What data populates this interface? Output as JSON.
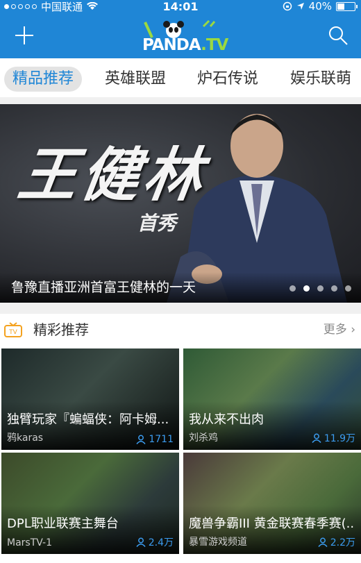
{
  "status_bar": {
    "carrier": "中国联通",
    "time": "14:01",
    "battery": "40%"
  },
  "header": {
    "logo_text": "PANDA",
    "logo_tv": ".TV"
  },
  "tabs": [
    {
      "label": "精品推荐"
    },
    {
      "label": "英雄联盟"
    },
    {
      "label": "炉石传说"
    },
    {
      "label": "娱乐联萌"
    }
  ],
  "banner": {
    "big_text": "王健林",
    "sub_text": "首秀",
    "caption": "鲁豫直播亚洲首富王健林的一天",
    "page_count": 5,
    "active_page": 1
  },
  "section": {
    "title": "精彩推荐",
    "more": "更多"
  },
  "cards": [
    {
      "title": "独臂玩家『蝙蝠侠：阿卡姆...",
      "anchor": "鸦karas",
      "views": "1711"
    },
    {
      "title": "我从来不出肉",
      "anchor": "刘杀鸡",
      "views": "11.9万"
    },
    {
      "title": "DPL职业联赛主舞台",
      "anchor": "MarsTV-1",
      "views": "2.4万"
    },
    {
      "title": "魔兽争霸III 黄金联赛春季赛(...",
      "anchor": "暴雪游戏频道",
      "views": "2.2万"
    }
  ]
}
